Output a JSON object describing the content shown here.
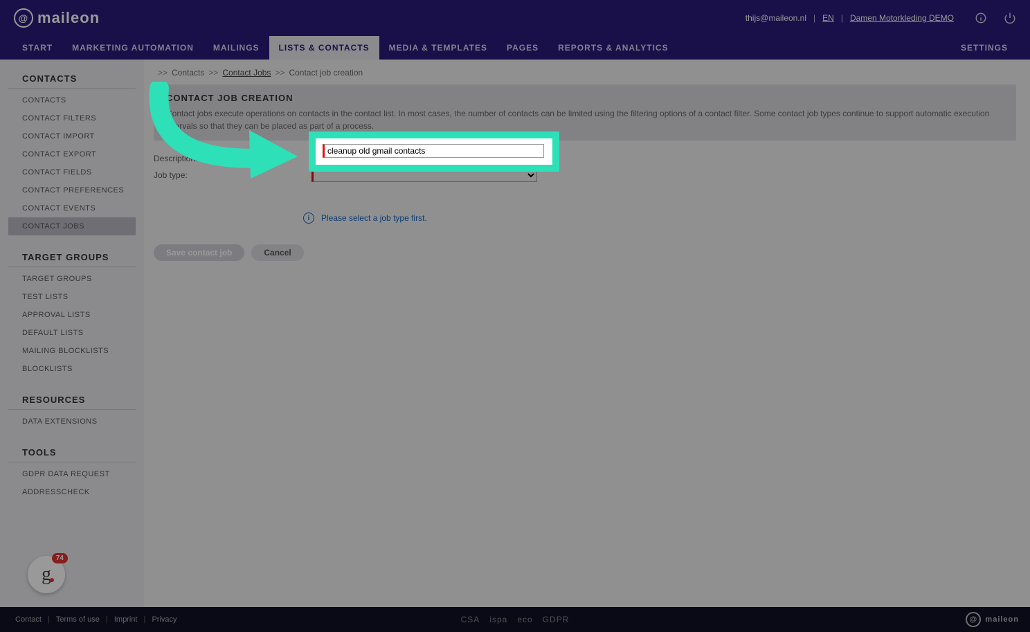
{
  "logo_text": "maileon",
  "header": {
    "user_email": "thijs@maileon.nl",
    "lang": "EN",
    "account": "Damen Motorkleding DEMO",
    "sep": "|"
  },
  "nav": {
    "tabs": [
      "START",
      "MARKETING AUTOMATION",
      "MAILINGS",
      "LISTS & CONTACTS",
      "MEDIA & TEMPLATES",
      "PAGES",
      "REPORTS & ANALYTICS"
    ],
    "right_tab": "SETTINGS",
    "active_index": 3
  },
  "sidebar": {
    "sections": [
      {
        "title": "CONTACTS",
        "items": [
          "CONTACTS",
          "CONTACT FILTERS",
          "CONTACT IMPORT",
          "CONTACT EXPORT",
          "CONTACT FIELDS",
          "CONTACT PREFERENCES",
          "CONTACT EVENTS",
          "CONTACT JOBS"
        ],
        "active_index": 7
      },
      {
        "title": "TARGET GROUPS",
        "items": [
          "TARGET GROUPS",
          "TEST LISTS",
          "APPROVAL LISTS",
          "DEFAULT LISTS",
          "MAILING BLOCKLISTS",
          "BLOCKLISTS"
        ],
        "active_index": -1
      },
      {
        "title": "RESOURCES",
        "items": [
          "DATA EXTENSIONS"
        ],
        "active_index": -1
      },
      {
        "title": "TOOLS",
        "items": [
          "GDPR DATA REQUEST",
          "ADDRESSCHECK"
        ],
        "active_index": -1
      }
    ]
  },
  "breadcrumb": {
    "sep": ">>",
    "items": [
      {
        "label": "Contacts",
        "link": false
      },
      {
        "label": "Contact Jobs",
        "link": true
      },
      {
        "label": "Contact job creation",
        "link": false
      }
    ]
  },
  "panel": {
    "title": "CONTACT JOB CREATION",
    "desc": "Contact jobs execute operations on contacts in the contact list. In most cases, the number of contacts can be limited using the filtering options of a contact filter. Some contact job types continue to support automatic execution intervals so that they can be placed as part of a process."
  },
  "form": {
    "description_label": "Description:",
    "description_value": "cleanup old gmail contacts",
    "jobtype_label": "Job type:",
    "jobtype_value": ""
  },
  "hint": "Please select a job type first.",
  "actions": {
    "save": "Save contact job",
    "cancel": "Cancel"
  },
  "footer": {
    "links": [
      "Contact",
      "Terms of use",
      "Imprint",
      "Privacy"
    ],
    "certs": [
      "CSA",
      "ispa",
      "eco",
      "GDPR"
    ],
    "sep": "|"
  },
  "widget": {
    "badge": "74",
    "letter": "g"
  }
}
